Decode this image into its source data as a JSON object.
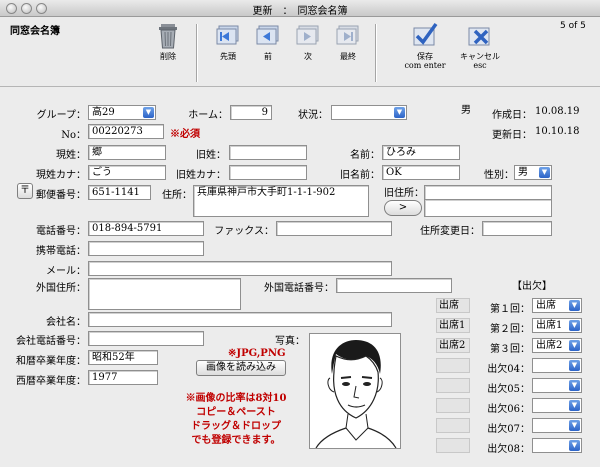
{
  "window": {
    "title": "更新　：　同窓会名簿",
    "record_counter": "5 of 5"
  },
  "app": {
    "name": "同窓会名簿"
  },
  "toolbar": {
    "delete": "削除",
    "first": "先頭",
    "prev": "前",
    "next": "次",
    "last": "最終",
    "save1": "保存",
    "save2": "com enter",
    "cancel1": "キャンセル",
    "cancel2": "esc"
  },
  "labels": {
    "group": "グループ：",
    "home": "ホーム：",
    "status": "状況：",
    "no": "No：",
    "required": "※必須",
    "surname": "現姓：",
    "old_surname": "旧姓：",
    "given": "名前：",
    "surname_kana": "現姓カナ：",
    "old_kana": "旧姓カナ：",
    "old_given": "旧名前：",
    "gender": "性別：",
    "postal_mark": "〒",
    "postal": "郵便番号：",
    "address": "住所：",
    "old_address": "旧住所：",
    "phone": "電話番号：",
    "fax": "ファックス：",
    "address_changed": "住所変更日：",
    "mobile": "携帯電話：",
    "mail": "メール：",
    "foreign_address": "外国住所：",
    "foreign_phone": "外国電話番号：",
    "company": "会社名：",
    "company_phone": "会社電話番号：",
    "grad_wareki": "和暦卒業年度：",
    "grad_seireki": "西暦卒業年度：",
    "photo": "写真：",
    "photo_note": "※JPG,PNG",
    "load_image": "画像を読み込み",
    "ratio_note": [
      "※画像の比率は8対10",
      "コピー＆ペースト",
      "ドラッグ＆ドロップ",
      "でも登録できます。"
    ],
    "created": "作成日：",
    "updated": "更新日：",
    "attendance_title": "【出欠】",
    "old_address_button": ">"
  },
  "values": {
    "group": "高29",
    "home": "9",
    "status": "",
    "gender_display": "男",
    "no": "00220273",
    "surname": "郷",
    "old_surname": "",
    "given": "ひろみ",
    "surname_kana": "ごう",
    "old_kana": "",
    "old_given": "OK",
    "gender": "男",
    "postal": "651-1141",
    "address": "兵庫県神戸市大手町1-1-1-902",
    "old_address": "",
    "phone": "018-894-5791",
    "fax": "",
    "address_changed": "",
    "mobile": "",
    "mail": "",
    "foreign_address": "",
    "foreign_phone": "",
    "company": "",
    "company_phone": "",
    "grad_wareki": "昭和52年",
    "grad_seireki": "1977",
    "created": "10.08.19",
    "updated": "10.10.18"
  },
  "attendance_left": [
    "出席",
    "出席1",
    "出席2",
    "",
    "",
    "",
    "",
    ""
  ],
  "attendance_rows": [
    {
      "label": "第１回：",
      "value": "出席"
    },
    {
      "label": "第２回：",
      "value": "出席1"
    },
    {
      "label": "第３回：",
      "value": "出席2"
    },
    {
      "label": "出欠04：",
      "value": ""
    },
    {
      "label": "出欠05：",
      "value": ""
    },
    {
      "label": "出欠06：",
      "value": ""
    },
    {
      "label": "出欠07：",
      "value": ""
    },
    {
      "label": "出欠08：",
      "value": ""
    }
  ]
}
